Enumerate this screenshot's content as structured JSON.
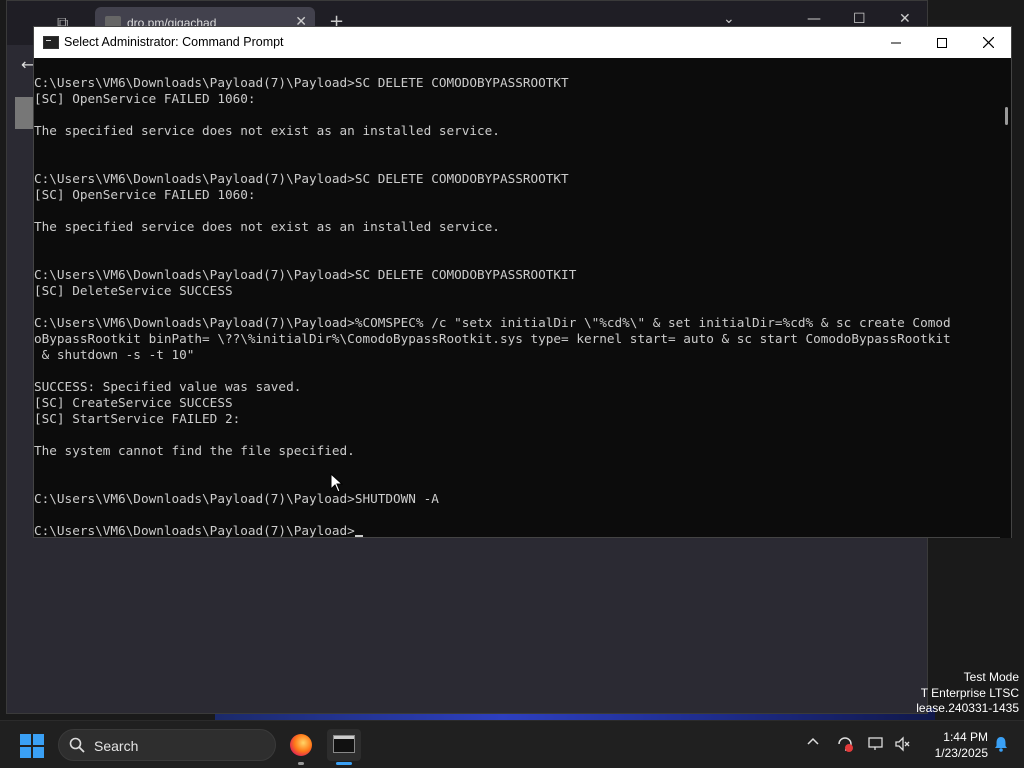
{
  "browser": {
    "tab_title": "dro.pm/gigachad"
  },
  "cmd": {
    "title": "Select Administrator: Command Prompt",
    "lines": [
      "C:\\Users\\VM6\\Downloads\\Payload(7)\\Payload>SC DELETE COMODOBYPASSROOTKT",
      "[SC] OpenService FAILED 1060:",
      "",
      "The specified service does not exist as an installed service.",
      "",
      "",
      "C:\\Users\\VM6\\Downloads\\Payload(7)\\Payload>SC DELETE COMODOBYPASSROOTKT",
      "[SC] OpenService FAILED 1060:",
      "",
      "The specified service does not exist as an installed service.",
      "",
      "",
      "C:\\Users\\VM6\\Downloads\\Payload(7)\\Payload>SC DELETE COMODOBYPASSROOTKIT",
      "[SC] DeleteService SUCCESS",
      "",
      "C:\\Users\\VM6\\Downloads\\Payload(7)\\Payload>%COMSPEC% /c \"setx initialDir \\\"%cd%\\\" & set initialDir=%cd% & sc create Comod",
      "oBypassRootkit binPath= \\??\\%initialDir%\\ComodoBypassRootkit.sys type= kernel start= auto & sc start ComodoBypassRootkit",
      " & shutdown -s -t 10\"",
      "",
      "SUCCESS: Specified value was saved.",
      "[SC] CreateService SUCCESS",
      "[SC] StartService FAILED 2:",
      "",
      "The system cannot find the file specified.",
      "",
      "",
      "C:\\Users\\VM6\\Downloads\\Payload(7)\\Payload>SHUTDOWN -A",
      ""
    ],
    "prompt": "C:\\Users\\VM6\\Downloads\\Payload(7)\\Payload>"
  },
  "watermark": {
    "line1": "Test Mode",
    "line2": "T Enterprise LTSC",
    "line3": "lease.240331-1435"
  },
  "taskbar": {
    "search_label": "Search",
    "time": "1:44 PM",
    "date": "1/23/2025"
  },
  "colors": {
    "accent": "#3aa0f5",
    "terminal_bg": "#0c0c0c",
    "terminal_fg": "#cccccc"
  }
}
